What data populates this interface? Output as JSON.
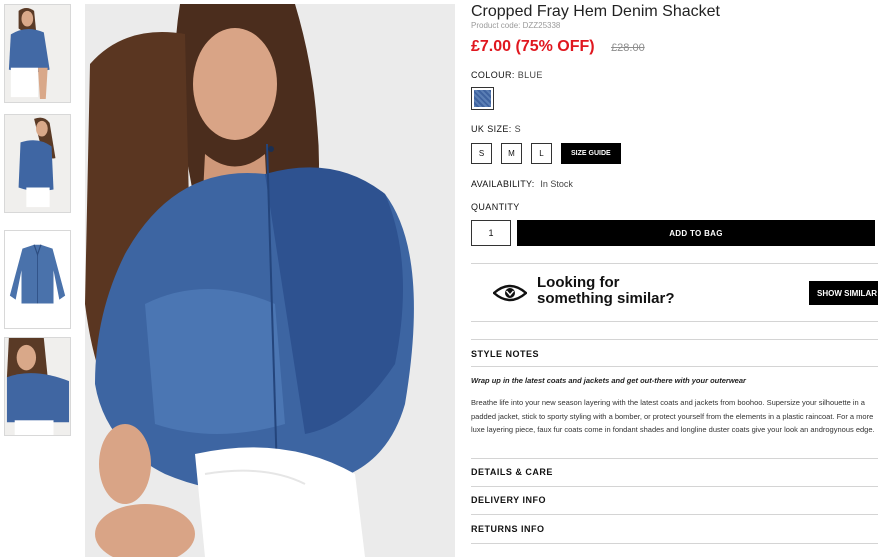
{
  "product": {
    "title": "Cropped Fray Hem Denim Shacket",
    "code": "Product code: DZZ25338",
    "price_now": "£7.00 (75% OFF)",
    "price_was": "£28.00"
  },
  "colour": {
    "label": "COLOUR:",
    "value": "BLUE",
    "swatch_color": "#4a6fa8"
  },
  "size": {
    "label": "UK SIZE:",
    "value": "S",
    "options": [
      "S",
      "M",
      "L"
    ],
    "guide_label": "SIZE GUIDE"
  },
  "availability": {
    "label": "AVAILABILITY:",
    "value": "In Stock"
  },
  "quantity": {
    "label": "QUANTITY",
    "value": "1"
  },
  "add_to_bag": "ADD TO BAG",
  "similar": {
    "line1": "Looking for",
    "line2": "something similar?",
    "button": "SHOW SIMILAR"
  },
  "style_notes": {
    "heading": "STYLE NOTES",
    "intro": "Wrap up in the latest coats and jackets and get out-there with your outerwear",
    "body": "Breathe life into your new season layering with the latest coats and jackets from boohoo. Supersize your silhouette in a padded jacket, stick to sporty styling with a bomber, or protect yourself from the elements in a plastic raincoat. For a more luxe layering piece, faux fur coats come in fondant shades and longline duster coats give your look an androgynous edge."
  },
  "sections": {
    "details": "DETAILS & CARE",
    "delivery": "DELIVERY INFO",
    "returns": "RETURNS INFO"
  },
  "colors": {
    "price_red": "#e0171f",
    "black": "#000000",
    "denim": "#4a6fa8"
  }
}
